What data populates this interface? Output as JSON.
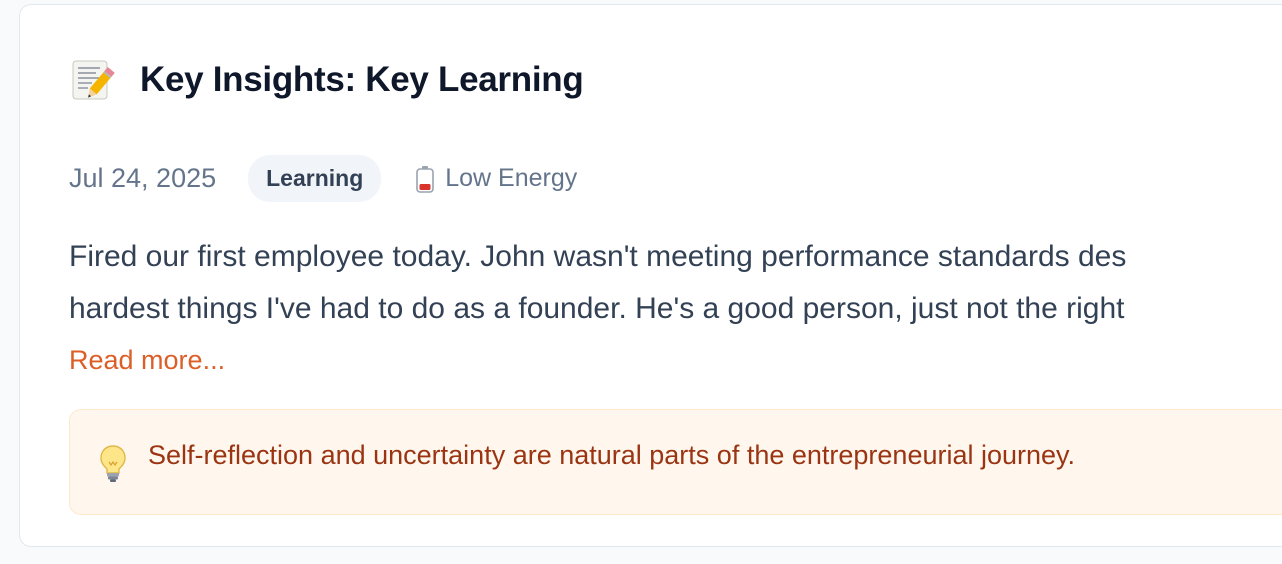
{
  "entry": {
    "title_icon": "memo-pencil-icon",
    "title": "Key Insights: Key Learning",
    "date": "Jul 24, 2025",
    "tag": "Learning",
    "energy_icon": "low-battery-icon",
    "energy_label": "Low Energy",
    "body_lines": [
      "Fired our first employee today. John wasn't meeting performance standards des",
      "hardest things I've had to do as a founder. He's a good person, just not the right"
    ],
    "read_more": "Read more...",
    "insight_icon": "lightbulb-icon",
    "insight_text": "Self-reflection and uncertainty are natural parts of the entrepreneurial journey."
  },
  "colors": {
    "accent": "#dc5f28",
    "insight_bg": "#fff7ed",
    "insight_text": "#9a3412",
    "title": "#0f172a",
    "muted": "#64748b"
  }
}
